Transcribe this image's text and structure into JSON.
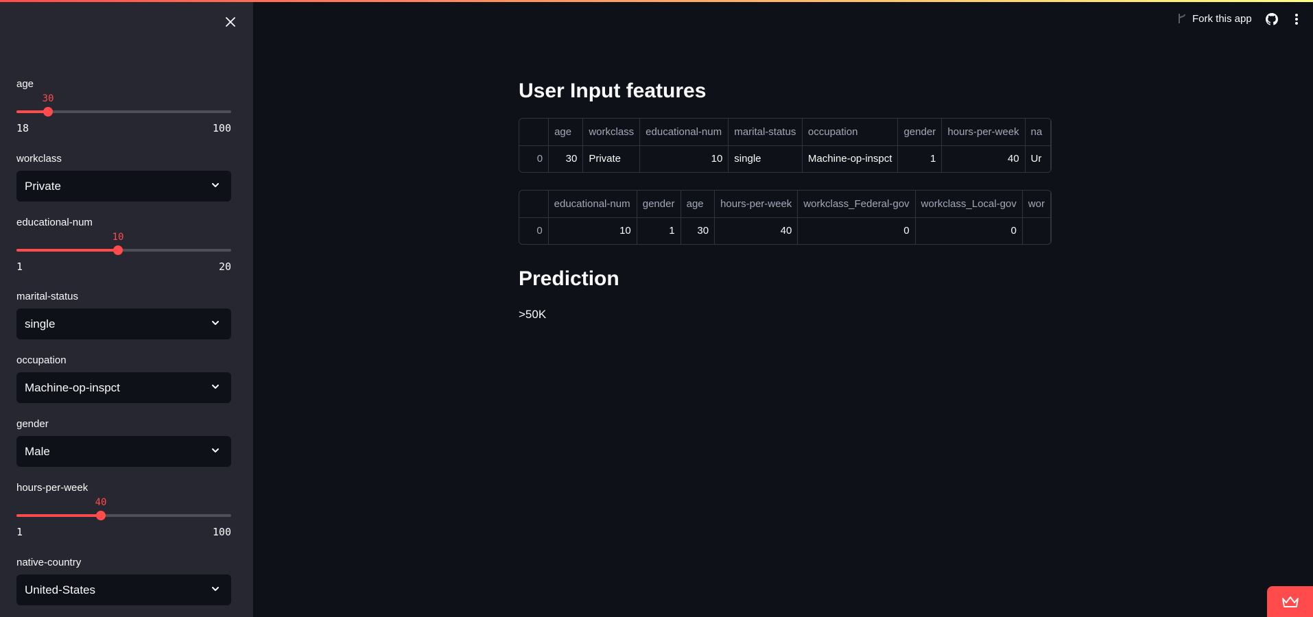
{
  "header": {
    "fork_label": "Fork this app",
    "github_icon": "github-icon",
    "menu_icon": "kebab-menu-icon"
  },
  "sidebar": {
    "close_icon": "close-icon",
    "age": {
      "label": "age",
      "value": "30",
      "min": "18",
      "max": "100",
      "fraction": 0.146
    },
    "workclass": {
      "label": "workclass",
      "selected": "Private"
    },
    "educational_num": {
      "label": "educational-num",
      "value": "10",
      "min": "1",
      "max": "20",
      "fraction": 0.474
    },
    "marital_status": {
      "label": "marital-status",
      "selected": "single"
    },
    "occupation": {
      "label": "occupation",
      "selected": "Machine-op-inspct"
    },
    "gender": {
      "label": "gender",
      "selected": "Male"
    },
    "hours_per_week": {
      "label": "hours-per-week",
      "value": "40",
      "min": "1",
      "max": "100",
      "fraction": 0.394
    },
    "native_country": {
      "label": "native-country",
      "selected": "United-States"
    }
  },
  "main": {
    "user_input_title": "User Input features",
    "table1": {
      "columns": [
        "",
        "age",
        "workclass",
        "educational-num",
        "marital-status",
        "occupation",
        "gender",
        "hours-per-week",
        "na"
      ],
      "row": [
        "0",
        "30",
        "Private",
        "10",
        "single",
        "Machine-op-inspct",
        "1",
        "40",
        "Ur"
      ]
    },
    "table2": {
      "columns": [
        "",
        "educational-num",
        "gender",
        "age",
        "hours-per-week",
        "workclass_Federal-gov",
        "workclass_Local-gov",
        "wor"
      ],
      "row": [
        "0",
        "10",
        "1",
        "30",
        "40",
        "0",
        "0",
        ""
      ]
    },
    "prediction_title": "Prediction",
    "prediction_value": ">50K"
  },
  "colors": {
    "accent": "#ff4b4b",
    "sidebar_bg": "#262730",
    "main_bg": "#0e1117"
  }
}
